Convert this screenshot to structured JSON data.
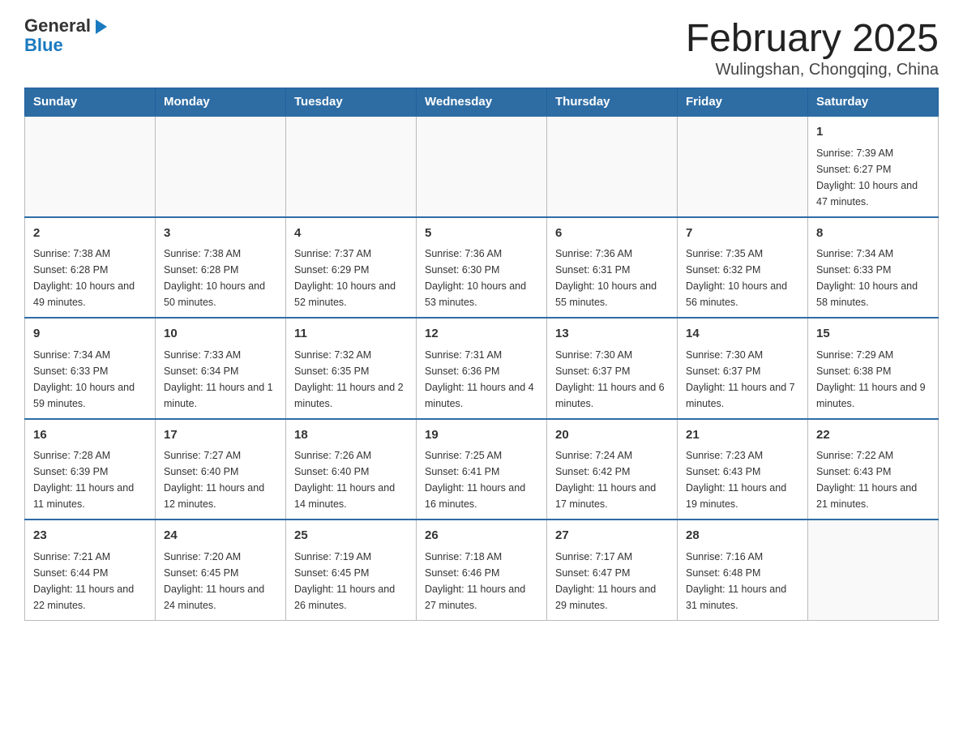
{
  "header": {
    "logo_general": "General",
    "logo_blue": "Blue",
    "title": "February 2025",
    "subtitle": "Wulingshan, Chongqing, China"
  },
  "days_of_week": [
    "Sunday",
    "Monday",
    "Tuesday",
    "Wednesday",
    "Thursday",
    "Friday",
    "Saturday"
  ],
  "weeks": [
    [
      {
        "day": "",
        "info": ""
      },
      {
        "day": "",
        "info": ""
      },
      {
        "day": "",
        "info": ""
      },
      {
        "day": "",
        "info": ""
      },
      {
        "day": "",
        "info": ""
      },
      {
        "day": "",
        "info": ""
      },
      {
        "day": "1",
        "info": "Sunrise: 7:39 AM\nSunset: 6:27 PM\nDaylight: 10 hours and 47 minutes."
      }
    ],
    [
      {
        "day": "2",
        "info": "Sunrise: 7:38 AM\nSunset: 6:28 PM\nDaylight: 10 hours and 49 minutes."
      },
      {
        "day": "3",
        "info": "Sunrise: 7:38 AM\nSunset: 6:28 PM\nDaylight: 10 hours and 50 minutes."
      },
      {
        "day": "4",
        "info": "Sunrise: 7:37 AM\nSunset: 6:29 PM\nDaylight: 10 hours and 52 minutes."
      },
      {
        "day": "5",
        "info": "Sunrise: 7:36 AM\nSunset: 6:30 PM\nDaylight: 10 hours and 53 minutes."
      },
      {
        "day": "6",
        "info": "Sunrise: 7:36 AM\nSunset: 6:31 PM\nDaylight: 10 hours and 55 minutes."
      },
      {
        "day": "7",
        "info": "Sunrise: 7:35 AM\nSunset: 6:32 PM\nDaylight: 10 hours and 56 minutes."
      },
      {
        "day": "8",
        "info": "Sunrise: 7:34 AM\nSunset: 6:33 PM\nDaylight: 10 hours and 58 minutes."
      }
    ],
    [
      {
        "day": "9",
        "info": "Sunrise: 7:34 AM\nSunset: 6:33 PM\nDaylight: 10 hours and 59 minutes."
      },
      {
        "day": "10",
        "info": "Sunrise: 7:33 AM\nSunset: 6:34 PM\nDaylight: 11 hours and 1 minute."
      },
      {
        "day": "11",
        "info": "Sunrise: 7:32 AM\nSunset: 6:35 PM\nDaylight: 11 hours and 2 minutes."
      },
      {
        "day": "12",
        "info": "Sunrise: 7:31 AM\nSunset: 6:36 PM\nDaylight: 11 hours and 4 minutes."
      },
      {
        "day": "13",
        "info": "Sunrise: 7:30 AM\nSunset: 6:37 PM\nDaylight: 11 hours and 6 minutes."
      },
      {
        "day": "14",
        "info": "Sunrise: 7:30 AM\nSunset: 6:37 PM\nDaylight: 11 hours and 7 minutes."
      },
      {
        "day": "15",
        "info": "Sunrise: 7:29 AM\nSunset: 6:38 PM\nDaylight: 11 hours and 9 minutes."
      }
    ],
    [
      {
        "day": "16",
        "info": "Sunrise: 7:28 AM\nSunset: 6:39 PM\nDaylight: 11 hours and 11 minutes."
      },
      {
        "day": "17",
        "info": "Sunrise: 7:27 AM\nSunset: 6:40 PM\nDaylight: 11 hours and 12 minutes."
      },
      {
        "day": "18",
        "info": "Sunrise: 7:26 AM\nSunset: 6:40 PM\nDaylight: 11 hours and 14 minutes."
      },
      {
        "day": "19",
        "info": "Sunrise: 7:25 AM\nSunset: 6:41 PM\nDaylight: 11 hours and 16 minutes."
      },
      {
        "day": "20",
        "info": "Sunrise: 7:24 AM\nSunset: 6:42 PM\nDaylight: 11 hours and 17 minutes."
      },
      {
        "day": "21",
        "info": "Sunrise: 7:23 AM\nSunset: 6:43 PM\nDaylight: 11 hours and 19 minutes."
      },
      {
        "day": "22",
        "info": "Sunrise: 7:22 AM\nSunset: 6:43 PM\nDaylight: 11 hours and 21 minutes."
      }
    ],
    [
      {
        "day": "23",
        "info": "Sunrise: 7:21 AM\nSunset: 6:44 PM\nDaylight: 11 hours and 22 minutes."
      },
      {
        "day": "24",
        "info": "Sunrise: 7:20 AM\nSunset: 6:45 PM\nDaylight: 11 hours and 24 minutes."
      },
      {
        "day": "25",
        "info": "Sunrise: 7:19 AM\nSunset: 6:45 PM\nDaylight: 11 hours and 26 minutes."
      },
      {
        "day": "26",
        "info": "Sunrise: 7:18 AM\nSunset: 6:46 PM\nDaylight: 11 hours and 27 minutes."
      },
      {
        "day": "27",
        "info": "Sunrise: 7:17 AM\nSunset: 6:47 PM\nDaylight: 11 hours and 29 minutes."
      },
      {
        "day": "28",
        "info": "Sunrise: 7:16 AM\nSunset: 6:48 PM\nDaylight: 11 hours and 31 minutes."
      },
      {
        "day": "",
        "info": ""
      }
    ]
  ]
}
